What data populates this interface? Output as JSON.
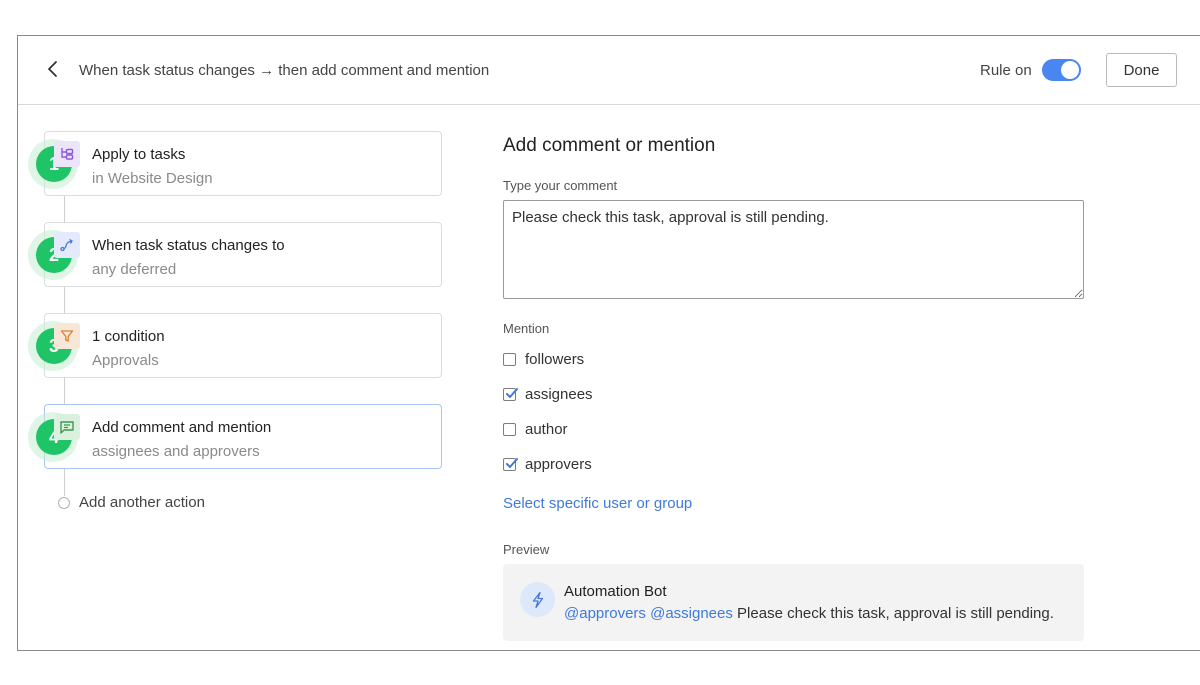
{
  "header": {
    "back_icon": "chevron-left-icon",
    "title": "When task status changes → then add comment and mention",
    "rule_label": "Rule on",
    "rule_on": true,
    "done_label": "Done"
  },
  "steps": [
    {
      "number": "1",
      "title": "Apply to tasks",
      "subtitle": "in Website Design",
      "icon": "hierarchy-icon",
      "icon_bg": "#ece4f8",
      "icon_color": "#8a5cd6"
    },
    {
      "number": "2",
      "title": "When task status changes to",
      "subtitle": "any deferred",
      "icon": "route-arrow-icon",
      "icon_bg": "#e2eafb",
      "icon_color": "#4b78d8"
    },
    {
      "number": "3",
      "title": "1 condition",
      "subtitle": "Approvals",
      "icon": "funnel-icon",
      "icon_bg": "#f8e6d8",
      "icon_color": "#d9822b"
    },
    {
      "number": "4",
      "title": "Add comment and mention",
      "subtitle": "assignees and approvers",
      "icon": "comment-icon",
      "icon_bg": "#dcf0df",
      "icon_color": "#3c9b4f",
      "active": true
    }
  ],
  "add_action_label": "Add another action",
  "panel": {
    "title": "Add comment or mention",
    "comment_label": "Type your comment",
    "comment_value": "Please check this task, approval is still pending.",
    "mention_label": "Mention",
    "mention_options": [
      {
        "label": "followers",
        "checked": false
      },
      {
        "label": "assignees",
        "checked": true
      },
      {
        "label": "author",
        "checked": false
      },
      {
        "label": "approvers",
        "checked": true
      }
    ],
    "select_link": "Select specific user or group",
    "preview_label": "Preview",
    "preview": {
      "bot_icon": "lightning-icon",
      "bot_name": "Automation Bot",
      "mentions": "@approvers @assignees",
      "message": "Please check this task, approval is still pending."
    }
  },
  "colors": {
    "accent": "#4a86f0",
    "link": "#3f7ad9",
    "badge": "#1fc466"
  }
}
